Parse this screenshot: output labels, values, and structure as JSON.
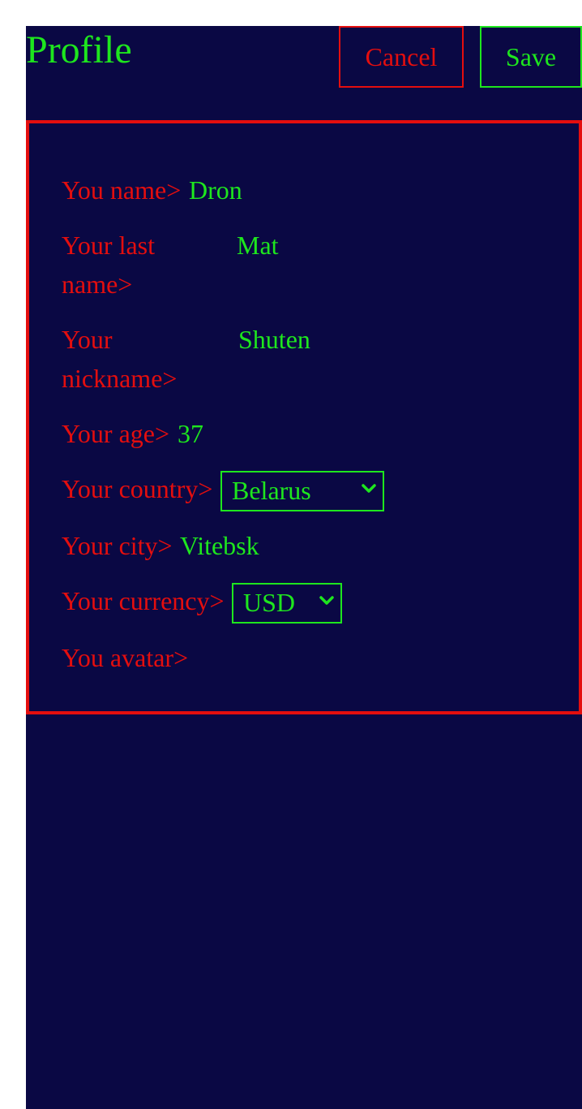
{
  "header": {
    "title": "Profile",
    "cancel_label": "Cancel",
    "save_label": "Save"
  },
  "form": {
    "name": {
      "label": "You name>",
      "value": "Dron"
    },
    "last_name": {
      "label": "Your last name>",
      "value": "Mat"
    },
    "nickname": {
      "label": "Your nickname>",
      "value": "Shuten"
    },
    "age": {
      "label": "Your age>",
      "value": "37"
    },
    "country": {
      "label": "Your country>",
      "value": "Belarus"
    },
    "city": {
      "label": "Your city>",
      "value": "Vitebsk"
    },
    "currency": {
      "label": "Your currency>",
      "value": "USD"
    },
    "avatar": {
      "label": "You avatar>"
    }
  },
  "colors": {
    "background": "#0a0844",
    "accent_green": "#1ee61e",
    "accent_red": "#e40e0e"
  },
  "icons": {
    "select_arrow": "chevron-down-icon"
  }
}
